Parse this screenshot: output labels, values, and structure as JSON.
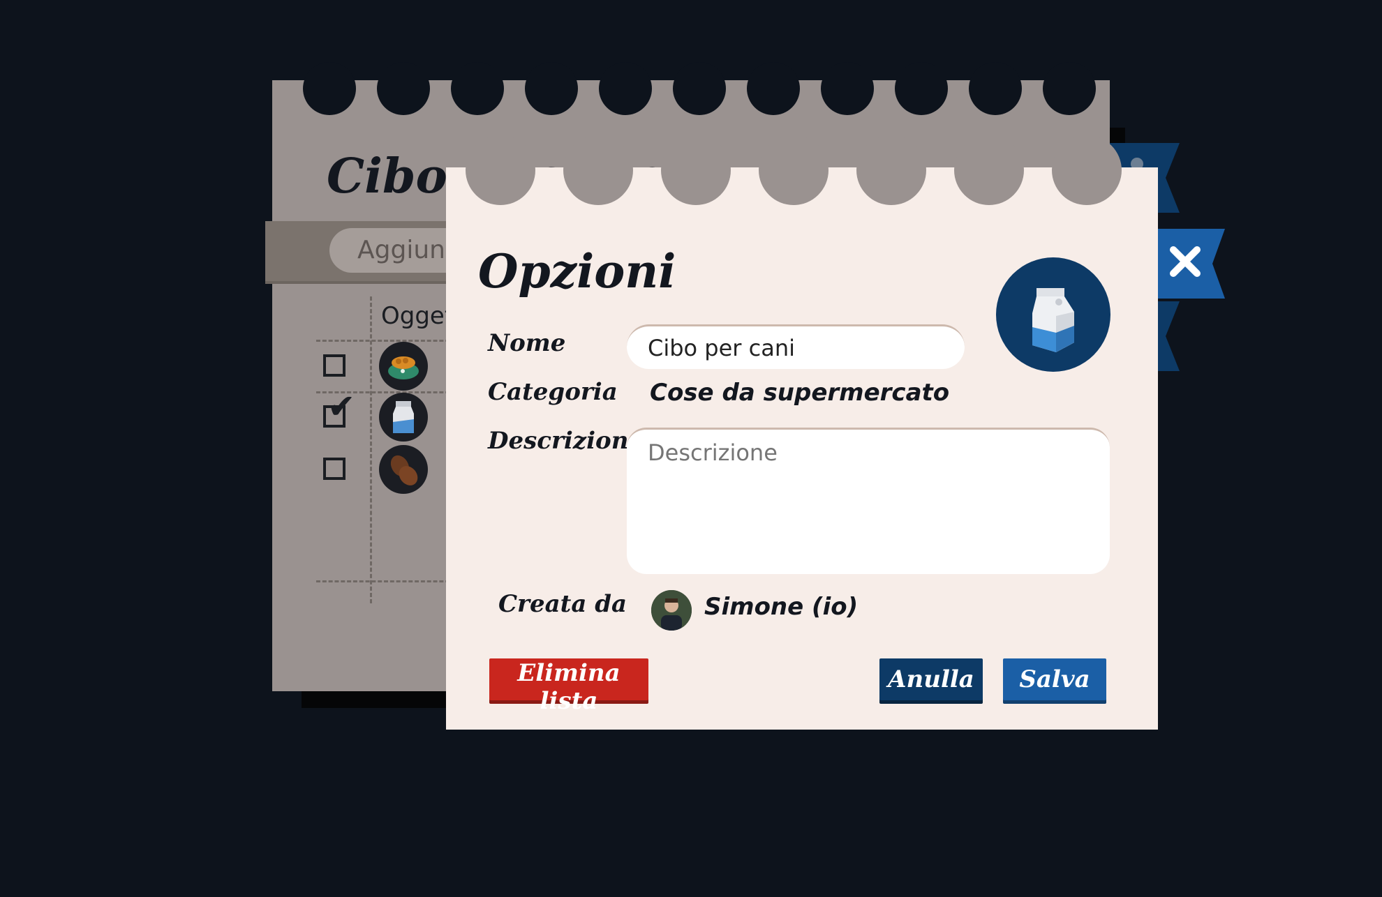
{
  "background_list": {
    "title": "Cibo per cani",
    "search_placeholder": "Aggiungi",
    "column_header": "Oggetti",
    "rows": [
      {
        "checked": false,
        "icon": "dog-food-bowl-icon"
      },
      {
        "checked": true,
        "icon": "milk-carton-icon"
      },
      {
        "checked": false,
        "icon": "coffee-beans-icon"
      }
    ],
    "check_mark": "✔"
  },
  "dialog": {
    "title": "Opzioni",
    "fields": {
      "name_label": "Nome",
      "name_value": "Cibo per cani",
      "category_label": "Categoria",
      "category_value": "Cose da supermercato",
      "description_label": "Descrizione",
      "description_placeholder": "Descrizione",
      "created_by_label": "Creata da",
      "created_by_value": "Simone (io)"
    },
    "item_icon": "milk-carton-icon",
    "buttons": {
      "delete": "Elimina lista",
      "cancel": "Anulla",
      "save": "Salva"
    },
    "close_icon": "✕"
  },
  "colors": {
    "page_bg": "#0d131c",
    "dialog_bg": "#f7ede8",
    "list_bg": "#9a9290",
    "primary_dark": "#0d3a66",
    "primary": "#1b5fa6",
    "danger": "#c9261e"
  }
}
